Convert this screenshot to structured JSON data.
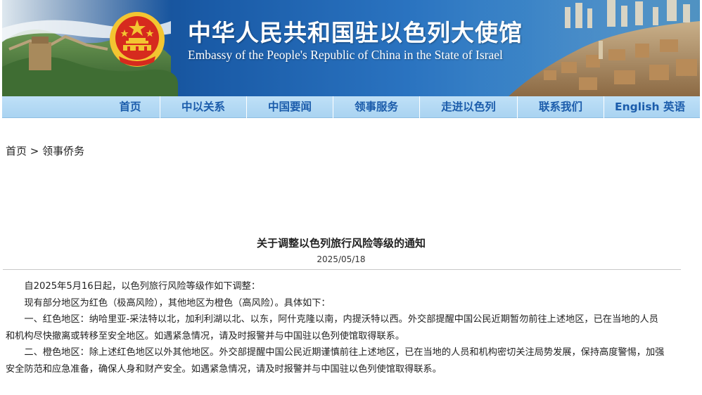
{
  "header": {
    "title_cn": "中华人民共和国驻以色列大使馆",
    "title_en": "Embassy of the People's Republic of China in the State of Israel",
    "emblem_icon": "national-emblem-icon"
  },
  "nav": {
    "items": [
      {
        "label": "首页"
      },
      {
        "label": "中以关系"
      },
      {
        "label": "中国要闻"
      },
      {
        "label": "领事服务"
      },
      {
        "label": "走进以色列"
      },
      {
        "label": "联系我们"
      },
      {
        "label": "English 英语"
      }
    ]
  },
  "breadcrumb": {
    "home": "首页",
    "separator": " > ",
    "current": "领事侨务"
  },
  "article": {
    "title": "关于调整以色列旅行风险等级的通知",
    "date": "2025/05/18",
    "paragraphs": [
      "自2025年5月16日起，以色列旅行风险等级作如下调整：",
      "现有部分地区为红色（极高风险），其他地区为橙色（高风险）。具体如下：",
      "一、红色地区：纳哈里亚-采法特以北，加利利湖以北、以东，阿什克隆以南，内提沃特以西。外交部提醒中国公民近期暂勿前往上述地区，已在当地的人员和机构尽快撤离或转移至安全地区。如遇紧急情况，请及时报警并与中国驻以色列使馆取得联系。",
      "二、橙色地区：除上述红色地区以外其他地区。外交部提醒中国公民近期谨慎前往上述地区，已在当地的人员和机构密切关注局势发展，保持高度警惕，加强安全防范和应急准备，确保人身和财产安全。如遇紧急情况，请及时报警并与中国驻以色列使馆取得联系。"
    ]
  },
  "colors": {
    "nav_text": "#1b5cab",
    "nav_bg": "#b6daf4",
    "banner_blue": "#1a5ba7",
    "emblem_red": "#d62a1e",
    "emblem_gold": "#f3c531"
  }
}
